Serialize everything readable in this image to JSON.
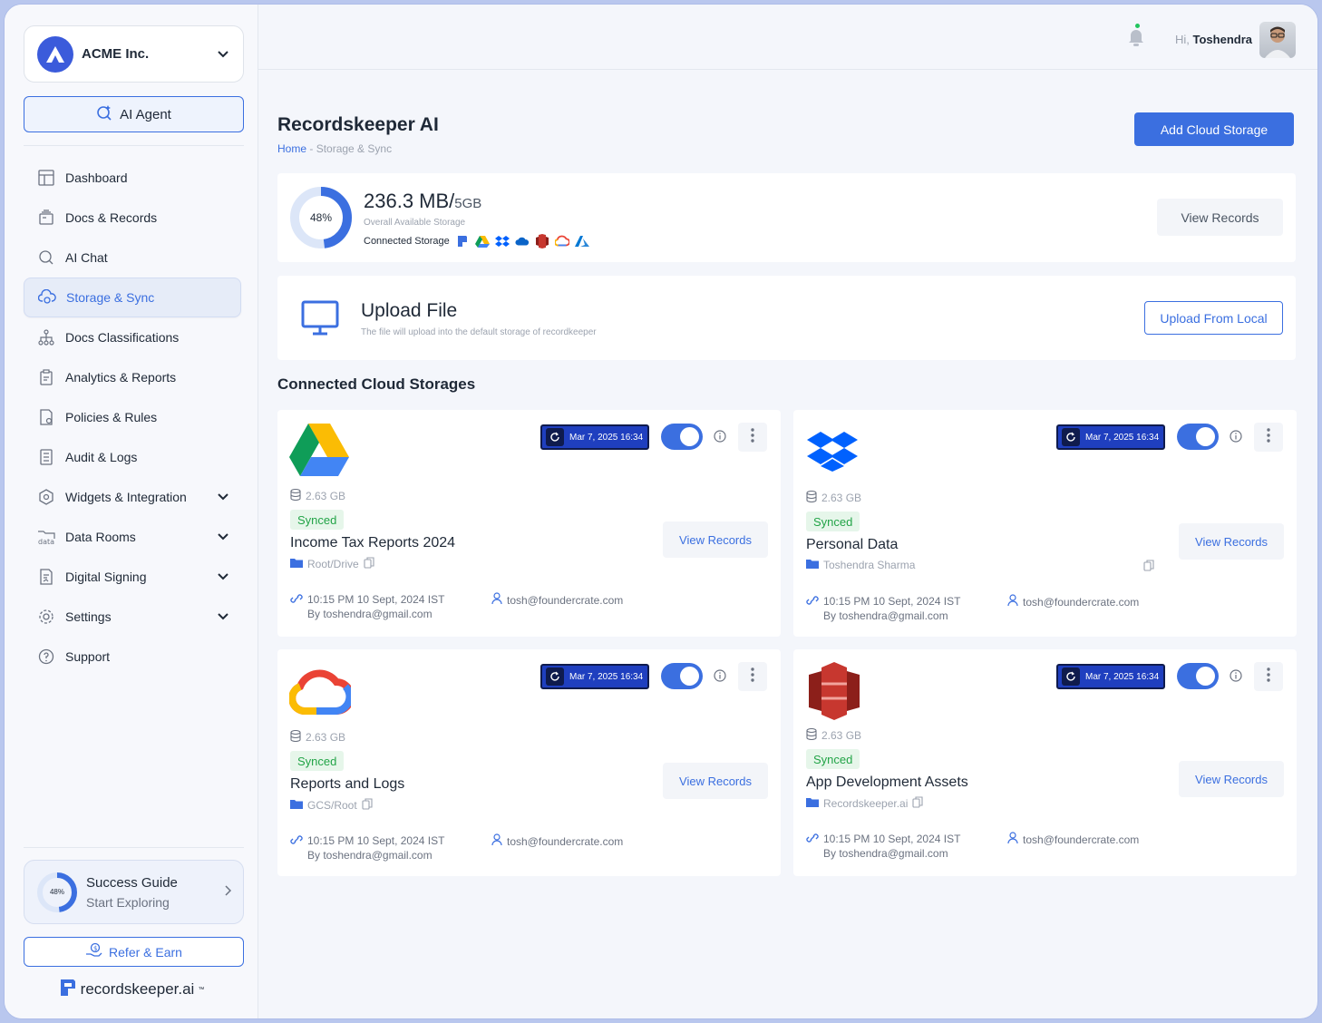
{
  "org": {
    "name": "ACME Inc."
  },
  "ai_agent": {
    "label": "AI Agent"
  },
  "nav": [
    {
      "label": "Dashboard",
      "icon": "dashboard-icon"
    },
    {
      "label": "Docs & Records",
      "icon": "docs-icon"
    },
    {
      "label": "AI Chat",
      "icon": "ai-chat-icon"
    },
    {
      "label": "Storage & Sync",
      "icon": "cloud-sync-icon",
      "active": true
    },
    {
      "label": "Docs Classifications",
      "icon": "hierarchy-icon"
    },
    {
      "label": "Analytics & Reports",
      "icon": "clipboard-icon"
    },
    {
      "label": "Policies & Rules",
      "icon": "policy-icon"
    },
    {
      "label": "Audit & Logs",
      "icon": "list-icon"
    },
    {
      "label": "Widgets & Integration",
      "icon": "widgets-icon",
      "expandable": true
    },
    {
      "label": "Data Rooms",
      "icon": "data-folder-icon",
      "expandable": true
    },
    {
      "label": "Digital Signing",
      "icon": "signing-icon",
      "expandable": true
    },
    {
      "label": "Settings",
      "icon": "gear-icon",
      "expandable": true
    },
    {
      "label": "Support",
      "icon": "help-icon"
    }
  ],
  "success_guide": {
    "percent": "48%",
    "progress": 0.48,
    "title": "Success Guide",
    "subtitle": "Start Exploring"
  },
  "refer": {
    "label": "Refer & Earn"
  },
  "brand": {
    "name": "recordskeeper.ai",
    "tm": "™"
  },
  "header": {
    "greeting": "Hi,",
    "user": "Toshendra"
  },
  "page": {
    "title": "Recordskeeper AI",
    "breadcrumb_home": "Home",
    "breadcrumb_sep": " - ",
    "breadcrumb_current": "Storage & Sync",
    "add_button": "Add Cloud Storage"
  },
  "storage": {
    "percent": "48%",
    "progress": 0.48,
    "used": "236.3 MB/",
    "total": "5GB",
    "caption": "Overall Available Storage",
    "connected_label": "Connected Storage",
    "view_button": "View Records"
  },
  "upload": {
    "title": "Upload File",
    "subtitle": "The file will upload into the default storage of recordkeeper",
    "button": "Upload From Local"
  },
  "section_title": "Connected Cloud Storages",
  "cards": [
    {
      "provider": "google-drive",
      "sync_time": "Mar 7, 2025 16:34",
      "size": "2.63 GB",
      "status": "Synced",
      "title": "Income Tax Reports 2024",
      "path": "Root/Drive",
      "time": "10:15 PM 10 Sept, 2024 IST",
      "by": "By toshendra@gmail.com",
      "email": "tosh@foundercrate.com",
      "view": "View Records",
      "enabled": true
    },
    {
      "provider": "dropbox",
      "sync_time": "Mar 7, 2025 16:34",
      "size": "2.63 GB",
      "status": "Synced",
      "title": "Personal Data",
      "path": "Toshendra Sharma",
      "time": "10:15 PM 10 Sept, 2024 IST",
      "by": "By toshendra@gmail.com",
      "email": "tosh@foundercrate.com",
      "view": "View Records",
      "enabled": true
    },
    {
      "provider": "google-cloud",
      "sync_time": "Mar 7, 2025 16:34",
      "size": "2.63 GB",
      "status": "Synced",
      "title": "Reports and Logs",
      "path": "GCS/Root",
      "time": "10:15 PM 10 Sept, 2024 IST",
      "by": "By toshendra@gmail.com",
      "email": "tosh@foundercrate.com",
      "view": "View Records",
      "enabled": true
    },
    {
      "provider": "aws-s3",
      "sync_time": "Mar 7, 2025 16:34",
      "size": "2.63 GB",
      "status": "Synced",
      "title": "App Development Assets",
      "path": "Recordskeeper.ai",
      "time": "10:15 PM 10 Sept, 2024 IST",
      "by": "By toshendra@gmail.com",
      "email": "tosh@foundercrate.com",
      "view": "View Records",
      "enabled": true
    }
  ],
  "colors": {
    "accent": "#3b6fe0",
    "synced": "#22a447",
    "badge": "#1f3fbf"
  }
}
